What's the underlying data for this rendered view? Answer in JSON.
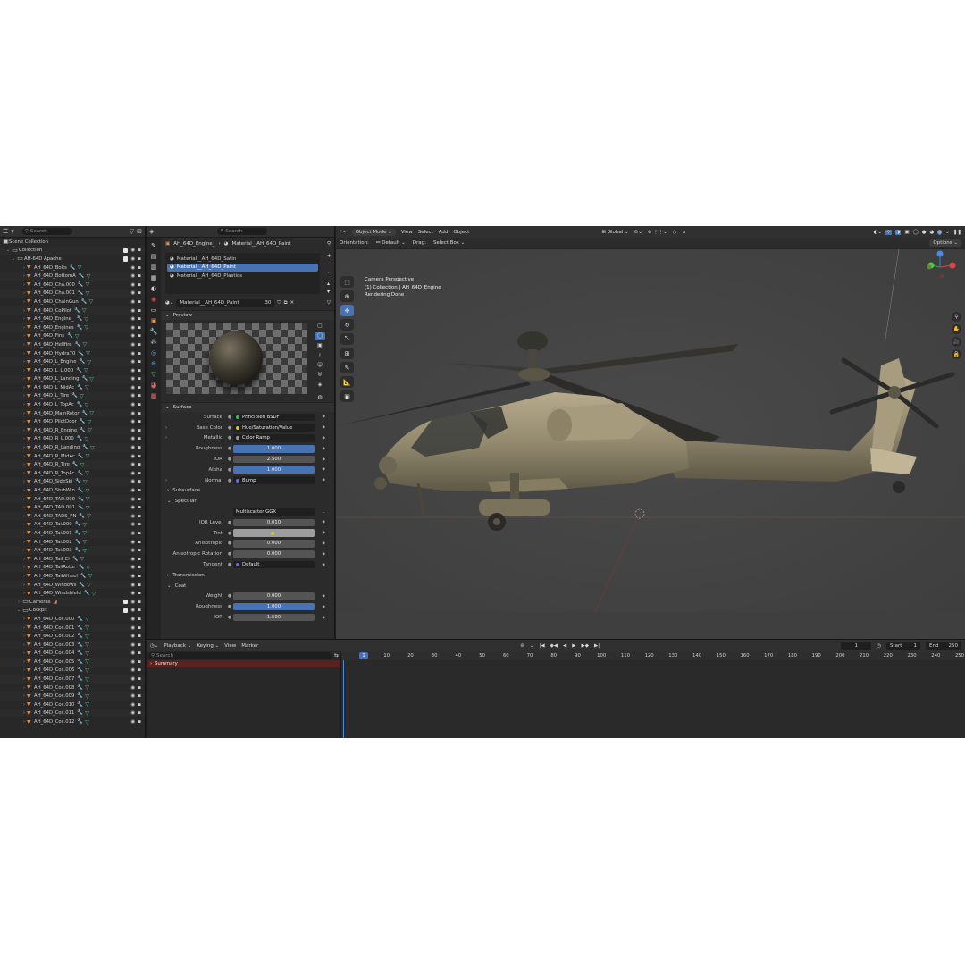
{
  "outliner": {
    "search_placeholder": "Search",
    "root": "Scene Collection",
    "collection": "Collection",
    "group": "AH-64D Apache",
    "items": [
      "AH_64D_Bolts",
      "AH_64D_BottomA",
      "AH_64D_Cha.000",
      "AH_64D_Cha.001",
      "AH_64D_ChainGun",
      "AH_64D_CoPilot",
      "AH_64D_Engine_",
      "AH_64D_Engines",
      "AH_64D_Fins",
      "AH_64D_Hellfire",
      "AH_64D_Hydra70",
      "AH_64D_L_Engine",
      "AH_64D_L_L.000",
      "AH_64D_L_Landing",
      "AH_64D_L_MidAc",
      "AH_64D_L_Tire",
      "AH_64D_L_TopAc",
      "AH_64D_MainRotor",
      "AH_64D_PilotDoor",
      "AH_64D_R_Engine",
      "AH_64D_R_L.000",
      "AH_64D_R_Landing",
      "AH_64D_R_MidAc",
      "AH_64D_R_Tire",
      "AH_64D_R_TopAc",
      "AH_64D_SideSki",
      "AH_64D_StubWin",
      "AH_64D_TAD.000",
      "AH_64D_TAD.001",
      "AH_64D_TADS_PN",
      "AH_64D_Tai.000",
      "AH_64D_Tai.001",
      "AH_64D_Tai.002",
      "AH_64D_Tai.003",
      "AH_64D_Tail_El",
      "AH_64D_TailRotor",
      "AH_64D_TailWheel",
      "AH_64D_Windows",
      "AH_64D_Windshield"
    ],
    "cameras": "Cameras",
    "cockpit": "Cockpit",
    "cockpit_items": [
      "AH_64D_Coc.000",
      "AH_64D_Coc.001",
      "AH_64D_Coc.002",
      "AH_64D_Coc.003",
      "AH_64D_Coc.004",
      "AH_64D_Coc.005",
      "AH_64D_Coc.006",
      "AH_64D_Coc.007",
      "AH_64D_Coc.008",
      "AH_64D_Coc.009",
      "AH_64D_Coc.010",
      "AH_64D_Coc.011",
      "AH_64D_Coc.012"
    ]
  },
  "properties": {
    "search_placeholder": "Search",
    "breadcrumb_object": "AH_64D_Engine_",
    "breadcrumb_material": "Material__AH_64D_Paint",
    "slots": [
      "Material__AH_64D_Satin",
      "Material__AH_64D_Paint",
      "Material__AH_64D_Plastics"
    ],
    "material_name": "Material__AH_64D_Paint",
    "user_count": "30",
    "preview_label": "Preview",
    "surface_panel": "Surface",
    "rows_top": [
      {
        "label": "Surface",
        "value": "Principled BSDF",
        "style": "dark",
        "dot": "#3fb56b"
      },
      {
        "label": "Base Color",
        "value": "Hue/Saturation/Value",
        "style": "dark",
        "dot": "#c9c93f",
        "arrow": true
      },
      {
        "label": "Metallic",
        "value": "Color Ramp",
        "style": "dark",
        "dot": "#9a9a9a",
        "arrow": true
      },
      {
        "label": "Roughness",
        "value": "1.000",
        "style": "blue"
      },
      {
        "label": "IOR",
        "value": "2.500",
        "style": "grey"
      },
      {
        "label": "Alpha",
        "value": "1.000",
        "style": "blue"
      },
      {
        "label": "Normal",
        "value": "Bump",
        "style": "dark",
        "dot": "#6b6bd6",
        "arrow": true
      }
    ],
    "subsurface": "Subsurface",
    "specular": "Specular",
    "distribution": "Multiscatter GGX",
    "rows_spec": [
      {
        "label": "IOR Level",
        "value": "0.010",
        "style": "grey"
      },
      {
        "label": "Tint",
        "value": "",
        "style": "light",
        "dot": "#c9c93f"
      },
      {
        "label": "Anisotropic",
        "value": "0.000",
        "style": "grey"
      },
      {
        "label": "Anisotropic Rotation",
        "value": "0.000",
        "style": "grey"
      },
      {
        "label": "Tangent",
        "value": "Default",
        "style": "dark",
        "dot": "#6b6bd6"
      }
    ],
    "transmission": "Transmission",
    "coat": "Coat",
    "rows_coat": [
      {
        "label": "Weight",
        "value": "0.000",
        "style": "grey"
      },
      {
        "label": "Roughness",
        "value": "1.000",
        "style": "blue"
      },
      {
        "label": "IOR",
        "value": "1.500",
        "style": "grey"
      }
    ]
  },
  "viewport": {
    "mode": "Object Mode",
    "menus": [
      "View",
      "Select",
      "Add",
      "Object"
    ],
    "transform": "Global",
    "orientation_label": "Orientation:",
    "orientation_value": "Default",
    "drag_label": "Drag:",
    "drag_value": "Select Box",
    "options": "Options",
    "overlay_line1": "Camera Perspective",
    "overlay_line2": "(1) Collection | AH_64D_Engine_",
    "overlay_line3": "Rendering Done"
  },
  "timeline": {
    "menus": [
      "Playback",
      "Keying",
      "View",
      "Marker"
    ],
    "current_frame": "1",
    "start_label": "Start",
    "start": "1",
    "end_label": "End",
    "end": "250",
    "search_placeholder": "Search",
    "summary": "Summary",
    "ticks": [
      "10",
      "20",
      "30",
      "40",
      "50",
      "60",
      "70",
      "80",
      "90",
      "100",
      "110",
      "120",
      "130",
      "140",
      "150",
      "160",
      "170",
      "180",
      "190",
      "200",
      "210",
      "220",
      "230",
      "240",
      "250"
    ]
  },
  "colors": {
    "accent": "#4772b3",
    "summary": "#5a2121"
  }
}
